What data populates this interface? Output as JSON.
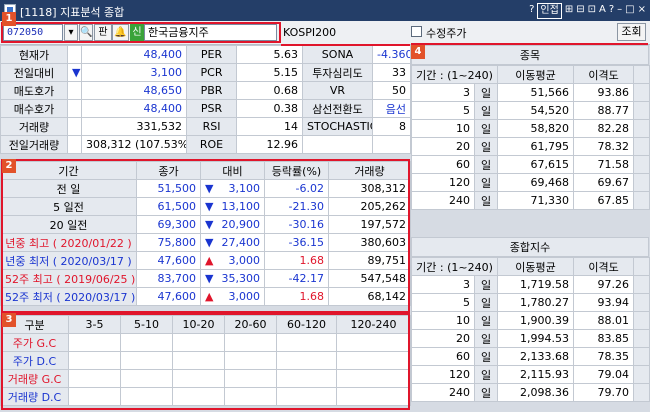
{
  "window": {
    "title": "[1118] 지표분석 종합",
    "buttons": [
      "?",
      "인접",
      "⊞",
      "⊟",
      "⊡",
      "A",
      "?",
      "–",
      "□",
      "×"
    ]
  },
  "toolbar": {
    "code": "072050",
    "pan_label": "판",
    "sin_label": "신",
    "stock_name": "한국금융지주",
    "index_name": "KOSPI200",
    "adj_label": "수정주가",
    "lookup": "조회"
  },
  "badges": [
    "1",
    "2",
    "3",
    "4"
  ],
  "summary": {
    "rows": [
      [
        "현재가",
        "",
        "48,400",
        "PER",
        "5.63",
        "SONA",
        "-4.360"
      ],
      [
        "전일대비",
        "▼",
        "3,100",
        "PCR",
        "5.15",
        "투자심리도",
        "33"
      ],
      [
        "매도호가",
        "",
        "48,650",
        "PBR",
        "0.68",
        "VR",
        "50"
      ],
      [
        "매수호가",
        "",
        "48,400",
        "PSR",
        "0.38",
        "삼선전환도",
        "음선"
      ],
      [
        "거래량",
        "",
        "331,532",
        "RSI",
        "14",
        "STOCHASTIC",
        "8"
      ],
      [
        "전일거래량",
        "",
        "308,312 (107.53%)",
        "ROE",
        "12.96",
        "",
        ""
      ]
    ]
  },
  "period": {
    "headers": [
      "기간",
      "종가",
      "대비",
      "등락률(%)",
      "거래량"
    ],
    "rows": [
      {
        "label": "전    일",
        "close": "51,500",
        "arrow": "▼",
        "diff": "3,100",
        "rate": "-6.02",
        "vol": "308,312",
        "color": "black"
      },
      {
        "label": "5   일전",
        "close": "61,500",
        "arrow": "▼",
        "diff": "13,100",
        "rate": "-21.30",
        "vol": "205,262",
        "color": "black"
      },
      {
        "label": "20   일전",
        "close": "69,300",
        "arrow": "▼",
        "diff": "20,900",
        "rate": "-30.16",
        "vol": "197,572",
        "color": "black"
      },
      {
        "label": "년중 최고 ( 2020/01/22 )",
        "close": "75,800",
        "arrow": "▼",
        "diff": "27,400",
        "rate": "-36.15",
        "vol": "380,603",
        "color": "red"
      },
      {
        "label": "년중 최저 ( 2020/03/17 )",
        "close": "47,600",
        "arrow": "▲",
        "diff": "3,000",
        "rate": "1.68",
        "vol": "89,751",
        "color": "blue"
      },
      {
        "label": "52주 최고 ( 2019/06/25 )",
        "close": "83,700",
        "arrow": "▼",
        "diff": "35,300",
        "rate": "-42.17",
        "vol": "547,548",
        "color": "red"
      },
      {
        "label": "52주 최저 ( 2020/03/17 )",
        "close": "47,600",
        "arrow": "▲",
        "diff": "3,000",
        "rate": "1.68",
        "vol": "68,142",
        "color": "blue"
      }
    ]
  },
  "signals": {
    "headers": [
      "구분",
      "3-5",
      "5-10",
      "10-20",
      "20-60",
      "60-120",
      "120-240"
    ],
    "rows": [
      {
        "label": "주가 G.C",
        "color": "red"
      },
      {
        "label": "주가 D.C",
        "color": "blue"
      },
      {
        "label": "거래량 G.C",
        "color": "red"
      },
      {
        "label": "거래량 D.C",
        "color": "blue"
      }
    ]
  },
  "stock_ma": {
    "title": "종목",
    "headers": [
      "기간 : (1~240)",
      "이동평균",
      "이격도"
    ],
    "rows": [
      [
        "3",
        "일",
        "51,566",
        "93.86"
      ],
      [
        "5",
        "일",
        "54,520",
        "88.77"
      ],
      [
        "10",
        "일",
        "58,820",
        "82.28"
      ],
      [
        "20",
        "일",
        "61,795",
        "78.32"
      ],
      [
        "60",
        "일",
        "67,615",
        "71.58"
      ],
      [
        "120",
        "일",
        "69,468",
        "69.67"
      ],
      [
        "240",
        "일",
        "71,330",
        "67.85"
      ]
    ]
  },
  "index_ma": {
    "title": "종합지수",
    "headers": [
      "기간 : (1~240)",
      "이동평균",
      "이격도"
    ],
    "rows": [
      [
        "3",
        "일",
        "1,719.58",
        "97.26"
      ],
      [
        "5",
        "일",
        "1,780.27",
        "93.94"
      ],
      [
        "10",
        "일",
        "1,900.39",
        "88.01"
      ],
      [
        "20",
        "일",
        "1,994.53",
        "83.85"
      ],
      [
        "60",
        "일",
        "2,133.68",
        "78.35"
      ],
      [
        "120",
        "일",
        "2,115.93",
        "79.04"
      ],
      [
        "240",
        "일",
        "2,098.36",
        "79.70"
      ]
    ]
  }
}
